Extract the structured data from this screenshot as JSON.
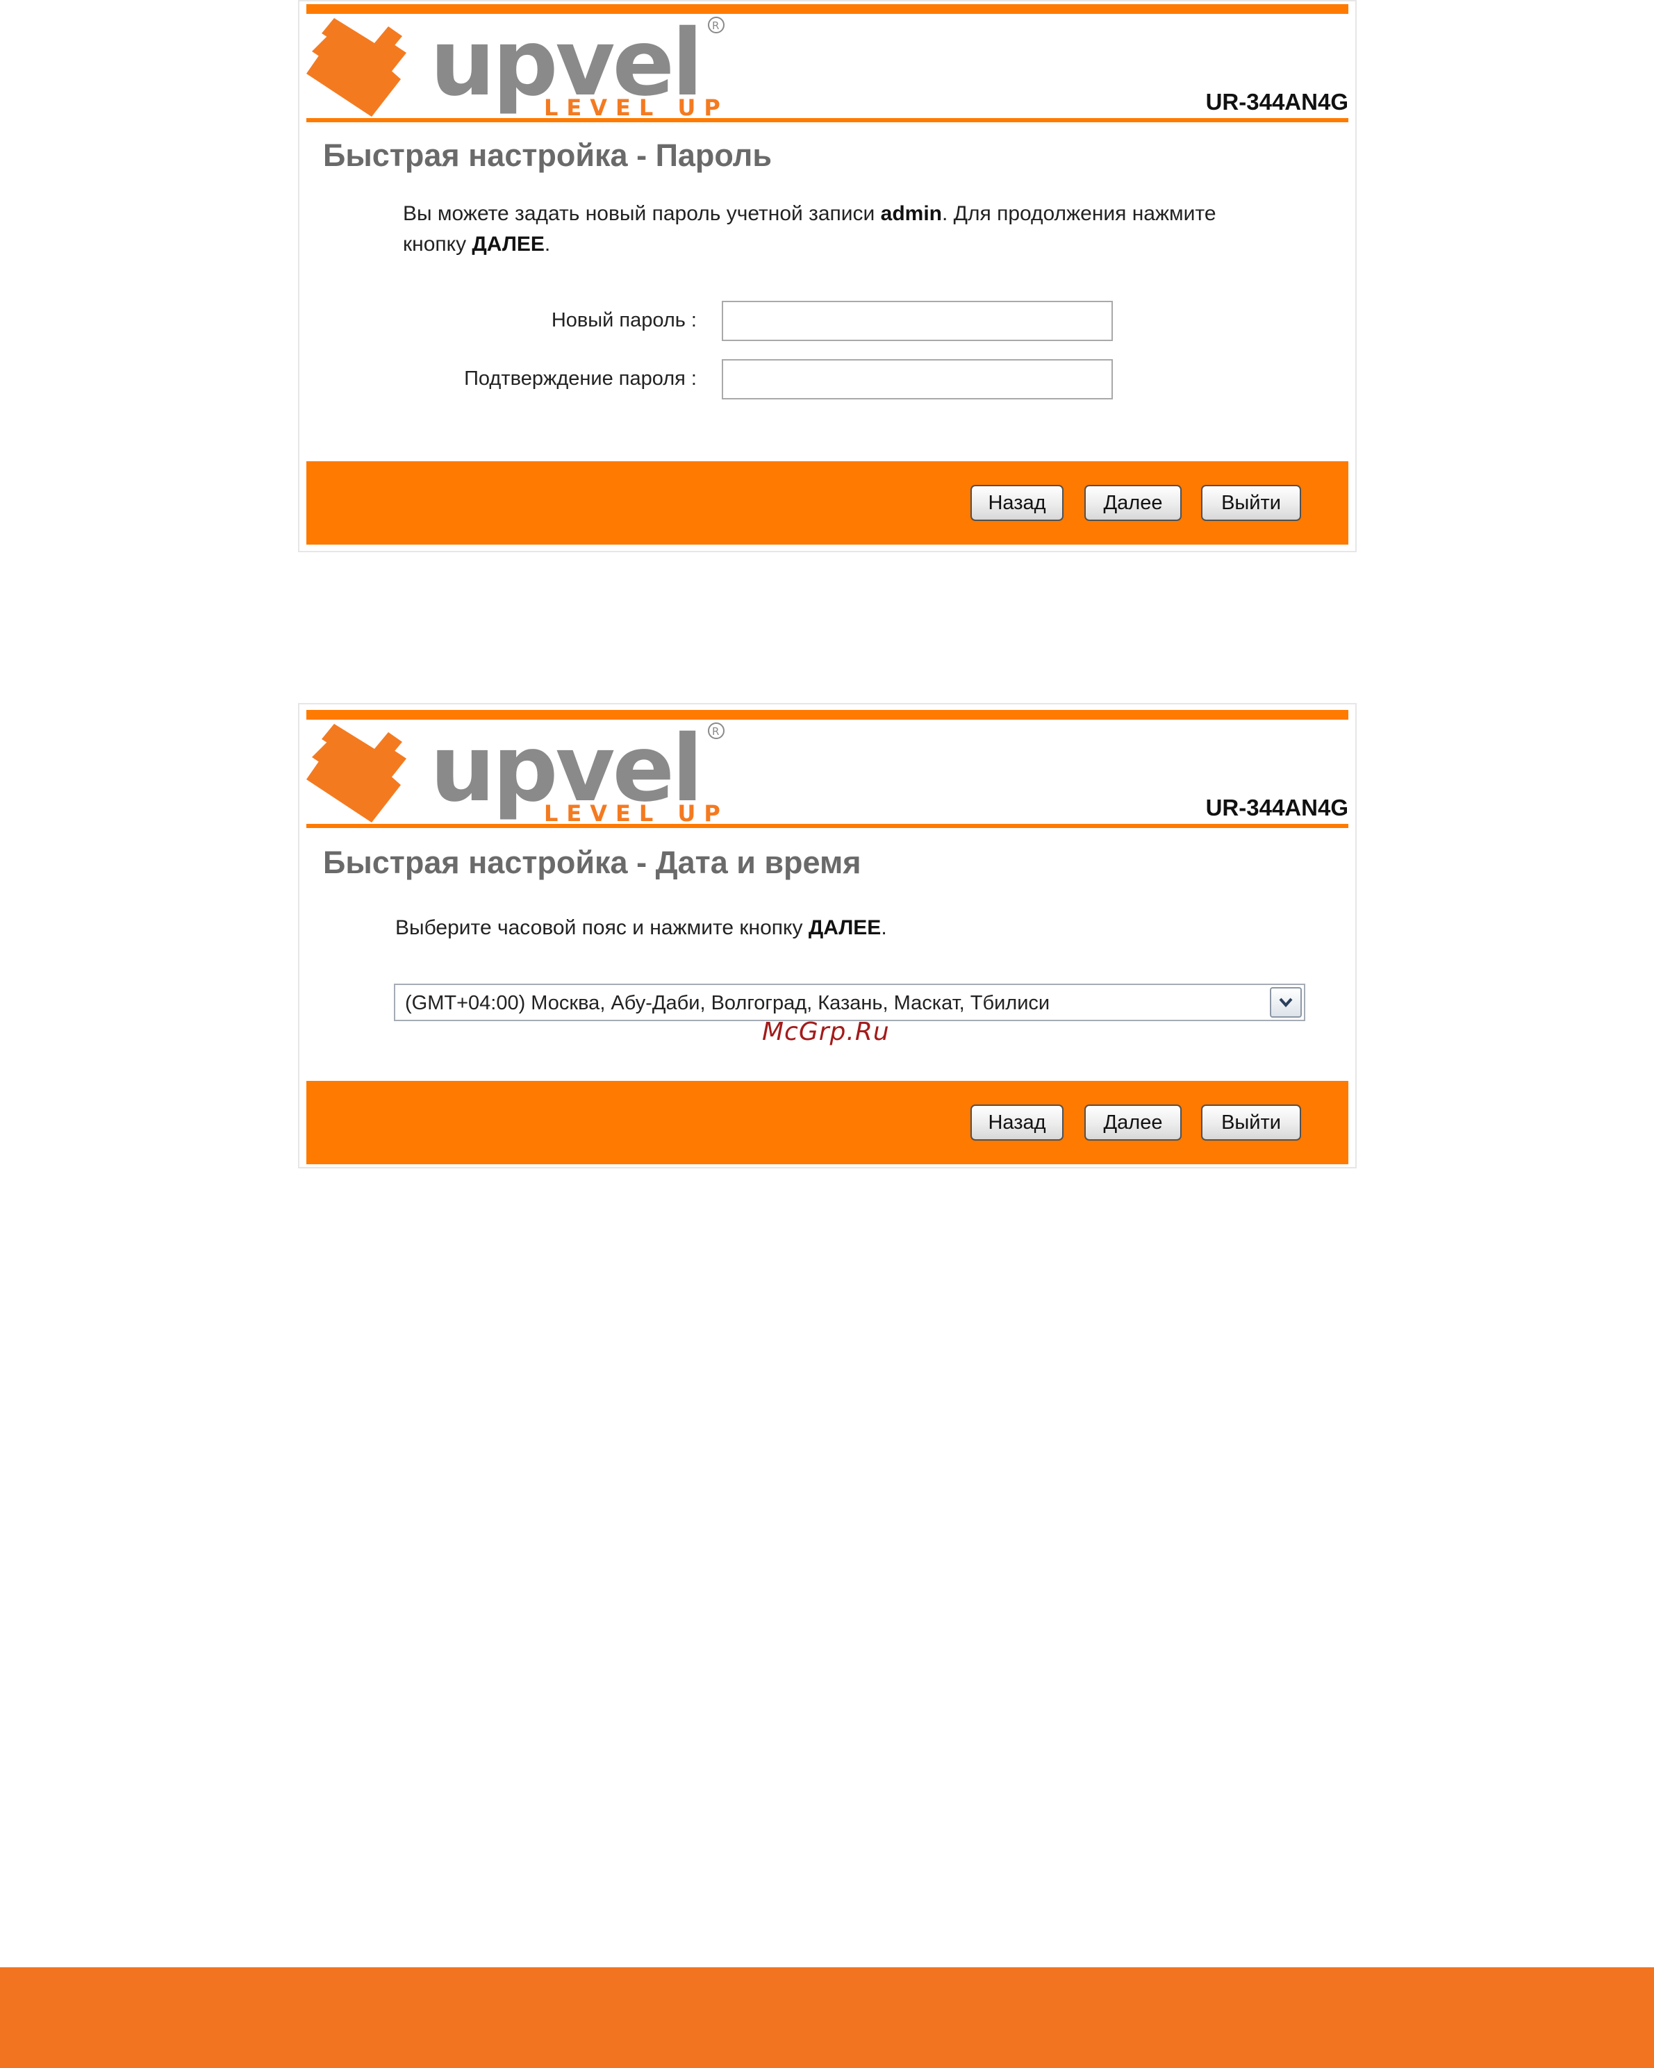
{
  "brand": {
    "logo_text": "upvel",
    "logo_tagline": "LEVEL UP",
    "model": "UR-344AN4G",
    "accent": "#ff7a00",
    "band_color": "#f27420"
  },
  "panel_password": {
    "title": "Быстрая настройка - Пароль",
    "desc_part1": "Вы можете задать новый пароль учетной записи ",
    "desc_account": "admin",
    "desc_part2": ". Для продолжения нажмите",
    "desc_part3": "кнопку ",
    "desc_next": "ДАЛЕЕ",
    "desc_end": ".",
    "fields": [
      {
        "label": "Новый пароль :",
        "value": ""
      },
      {
        "label": "Подтверждение пароля :",
        "value": ""
      }
    ],
    "buttons": {
      "back": "Назад",
      "next": "Далее",
      "exit": "Выйти"
    }
  },
  "panel_datetime": {
    "title": "Быстрая настройка - Дата и время",
    "desc_part1": "Выберите часовой пояс и нажмите кнопку ",
    "desc_next": "ДАЛЕЕ",
    "desc_end": ".",
    "timezone": {
      "selected": "(GMT+04:00) Москва, Абу-Даби, Волгоград, Казань, Маскат, Тбилиси",
      "icon": "chevron-down-icon"
    },
    "buttons": {
      "back": "Назад",
      "next": "Далее",
      "exit": "Выйти"
    }
  },
  "watermark": "McGrp.Ru"
}
